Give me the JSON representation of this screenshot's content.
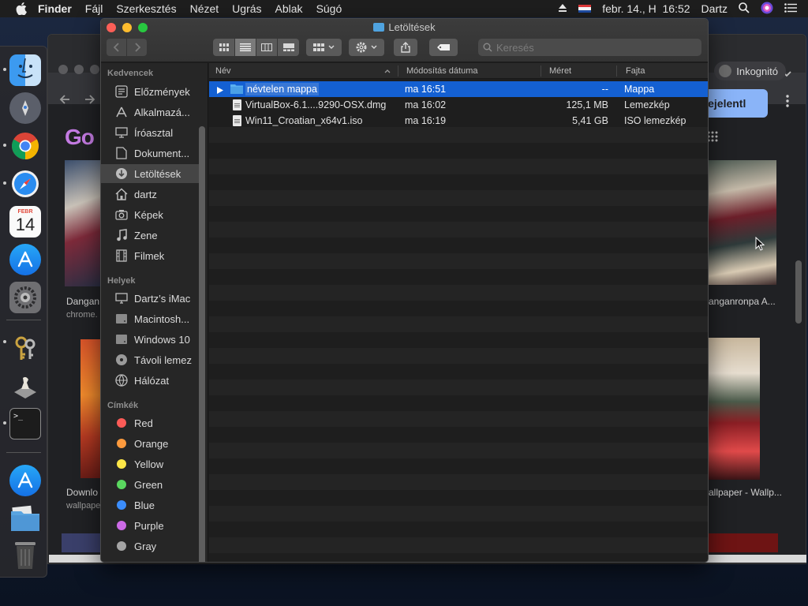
{
  "menubar": {
    "app_name": "Finder",
    "items": [
      "Fájl",
      "Szerkesztés",
      "Nézet",
      "Ugrás",
      "Ablak",
      "Súgó"
    ],
    "datetime": "febr. 14., H  16:52",
    "user": "Dartz"
  },
  "dock": {
    "items": [
      "finder-icon",
      "launchpad-icon",
      "chrome-icon",
      "safari-icon",
      "calendar-icon",
      "app-store-icon",
      "system-preferences-icon",
      "keychain-icon",
      "chess-icon",
      "terminal-icon",
      "app-store-icon",
      "folder-icon",
      "trash-icon"
    ],
    "calendar": {
      "month": "FEBR",
      "day": "14"
    }
  },
  "browser": {
    "logo_partial": "Go",
    "incognito_label": "Inkognitó",
    "signin_label": "Bejelentl",
    "results": [
      {
        "title": "Dangan",
        "source": "chrome."
      },
      {
        "title": "Downlo",
        "source": "wallpape"
      },
      {
        "title": "anganronpa A...",
        "source": ""
      },
      {
        "title": "allpaper - Wallp...",
        "source": ""
      }
    ]
  },
  "finder": {
    "title": "Letöltések",
    "search_placeholder": "Keresés",
    "sidebar": {
      "favorites_header": "Kedvencek",
      "favorites": [
        {
          "label": "Előzmények",
          "icon": "recents-icon"
        },
        {
          "label": "Alkalmazá...",
          "icon": "applications-icon"
        },
        {
          "label": "Íróasztal",
          "icon": "desktop-icon"
        },
        {
          "label": "Dokument...",
          "icon": "documents-icon"
        },
        {
          "label": "Letöltések",
          "icon": "downloads-icon"
        },
        {
          "label": "dartz",
          "icon": "home-icon"
        },
        {
          "label": "Képek",
          "icon": "pictures-icon"
        },
        {
          "label": "Zene",
          "icon": "music-icon"
        },
        {
          "label": "Filmek",
          "icon": "movies-icon"
        }
      ],
      "locations_header": "Helyek",
      "locations": [
        {
          "label": "Dartz’s iMac",
          "icon": "imac-icon"
        },
        {
          "label": "Macintosh...",
          "icon": "disk-icon"
        },
        {
          "label": "Windows 10",
          "icon": "disk-icon"
        },
        {
          "label": "Távoli lemez",
          "icon": "remote-disc-icon"
        },
        {
          "label": "Hálózat",
          "icon": "network-icon"
        }
      ],
      "tags_header": "Címkék",
      "tags": [
        {
          "label": "Red",
          "color": "#fc5b57"
        },
        {
          "label": "Orange",
          "color": "#fd9a3d"
        },
        {
          "label": "Yellow",
          "color": "#fde647"
        },
        {
          "label": "Green",
          "color": "#5ad75f"
        },
        {
          "label": "Blue",
          "color": "#3b8dfb"
        },
        {
          "label": "Purple",
          "color": "#cc6ae6"
        },
        {
          "label": "Gray",
          "color": "#a5a5a5"
        }
      ]
    },
    "columns": {
      "name": "Név",
      "modified": "Módosítás dátuma",
      "size": "Méret",
      "kind": "Fajta"
    },
    "files": [
      {
        "name": "névtelen mappa",
        "modified": "ma 16:51",
        "size": "--",
        "kind": "Mappa"
      },
      {
        "name": "VirtualBox-6.1....9290-OSX.dmg",
        "modified": "ma 16:02",
        "size": "125,1 MB",
        "kind": "Lemezkép"
      },
      {
        "name": "Win11_Croatian_x64v1.iso",
        "modified": "ma 16:19",
        "size": "5,41 GB",
        "kind": "ISO lemezkép"
      }
    ]
  }
}
